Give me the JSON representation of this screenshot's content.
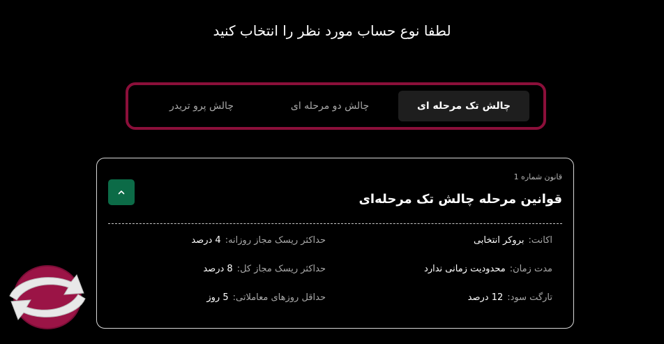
{
  "page": {
    "title": "لطفا نوع حساب مورد نظر را انتخاب کنید"
  },
  "tabs": [
    {
      "label": "چالش تک مرحله ای",
      "active": true
    },
    {
      "label": "چالش دو مرحله ای",
      "active": false
    },
    {
      "label": "چالش پرو تریدر",
      "active": false
    }
  ],
  "rules_card": {
    "rule_number": "قانون شماره 1",
    "title": "قوانین مرحله چالش تک مرحله‌ای",
    "collapse_icon": "chevron-up-icon",
    "items": [
      {
        "label": "اکانت:",
        "value": "بروکر انتخابی"
      },
      {
        "label": "حداکثر ریسک مجاز روزانه:",
        "value": "4 درصد"
      },
      {
        "label": "مدت زمان:",
        "value": "محدودیت زمانی ندارد"
      },
      {
        "label": "حداکثر ریسک مجاز کل:",
        "value": "8 درصد"
      },
      {
        "label": "تارگت سود:",
        "value": "12 درصد"
      },
      {
        "label": "حداقل روزهای معاملاتی:",
        "value": "5 روز"
      }
    ]
  },
  "colors": {
    "background": "#000000",
    "accent_border": "#8b0f3a",
    "button_green": "#0c6b47",
    "active_tab_bg": "#1e1e1e"
  },
  "icons": {
    "floating_badge": "sync-arrows-icon"
  }
}
